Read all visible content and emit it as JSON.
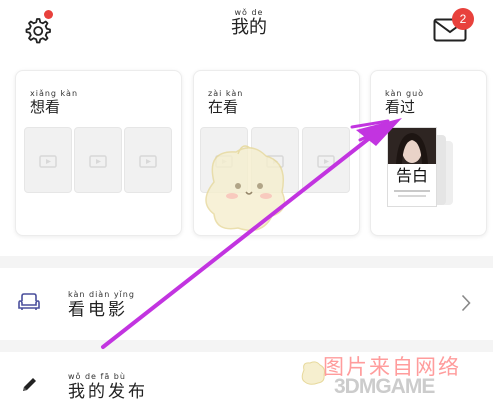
{
  "header": {
    "title": {
      "pinyin": "wǒ  de",
      "text": "我的"
    },
    "settings_icon": "gear-icon",
    "mail_icon": "mail-icon",
    "mail_badge": "2",
    "accent_red": "#e8413c"
  },
  "cards": [
    {
      "pinyin": "xiǎng kàn",
      "label": "想看"
    },
    {
      "pinyin": "zài  kàn",
      "label": "在看"
    },
    {
      "pinyin": "kàn  guò",
      "label": "看过"
    }
  ],
  "watched_poster": {
    "title": "告白"
  },
  "rows": [
    {
      "pinyin": "kàn diàn yǐng",
      "label": "看电影",
      "icon": "sofa-icon"
    },
    {
      "pinyin": "wǒ  de  fā  bù",
      "label": "我的发布",
      "icon": "pencil-icon"
    }
  ],
  "annotation": {
    "color": "#c234e0"
  },
  "watermark": {
    "cn": "图片来自网络",
    "en": "3DMGAME"
  }
}
